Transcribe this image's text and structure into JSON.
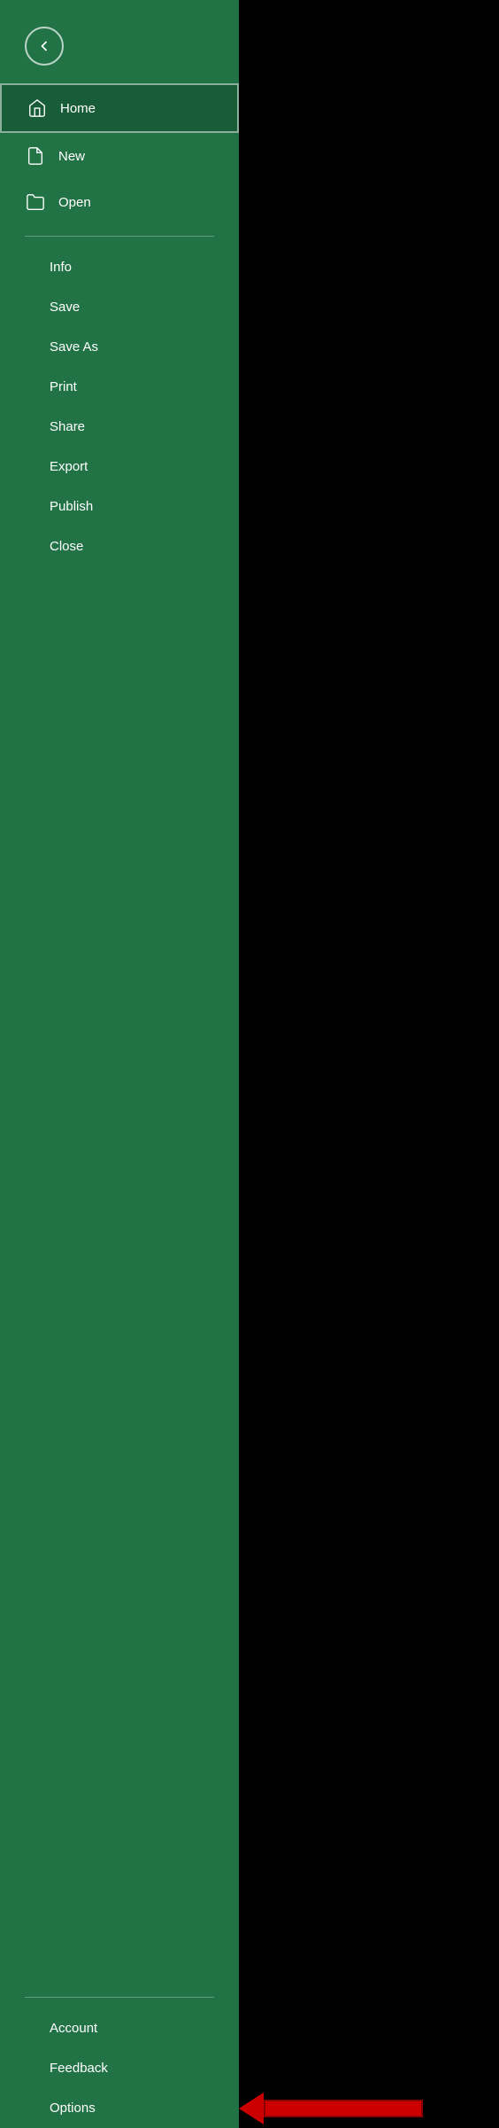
{
  "sidebar": {
    "back_button_label": "Back",
    "nav_items": [
      {
        "id": "home",
        "label": "Home",
        "icon": "home-icon",
        "active": true
      },
      {
        "id": "new",
        "label": "New",
        "icon": "new-icon",
        "active": false
      },
      {
        "id": "open",
        "label": "Open",
        "icon": "open-icon",
        "active": false
      }
    ],
    "menu_items": [
      {
        "id": "info",
        "label": "Info"
      },
      {
        "id": "save",
        "label": "Save"
      },
      {
        "id": "save-as",
        "label": "Save As"
      },
      {
        "id": "print",
        "label": "Print"
      },
      {
        "id": "share",
        "label": "Share"
      },
      {
        "id": "export",
        "label": "Export"
      },
      {
        "id": "publish",
        "label": "Publish"
      },
      {
        "id": "close",
        "label": "Close"
      }
    ],
    "bottom_items": [
      {
        "id": "account",
        "label": "Account"
      },
      {
        "id": "feedback",
        "label": "Feedback"
      },
      {
        "id": "options",
        "label": "Options"
      }
    ],
    "colors": {
      "background": "#217346",
      "active_bg": "#185c38",
      "hover_bg": "rgba(255,255,255,0.1)"
    }
  }
}
